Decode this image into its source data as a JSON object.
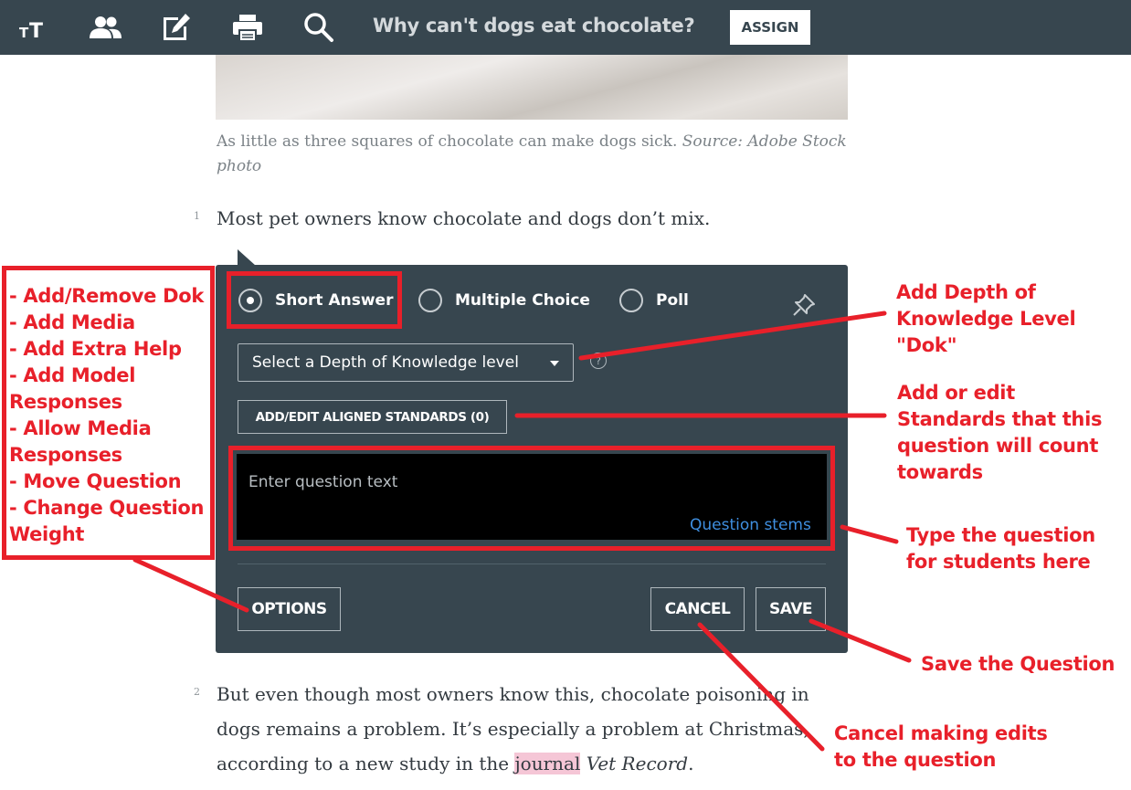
{
  "toolbar": {
    "icons": [
      "text-size-icon",
      "group-icon",
      "edit-icon",
      "print-icon",
      "search-icon"
    ],
    "title": "Why can't dogs eat chocolate?",
    "assign_label": "ASSIGN"
  },
  "article": {
    "caption_text": "As little as three squares of chocolate can make dogs sick. ",
    "caption_source": "Source: Adobe Stock photo",
    "para1_number": "1",
    "para1_text": "Most pet owners know chocolate and dogs don’t mix.",
    "para2_number": "2",
    "para2_line1": "But even though most owners know this, chocolate poisoning in",
    "para2_line2": "dogs remains a problem. It’s especially a problem at Christmas,",
    "para2_line3_pre": "according to a new study in the ",
    "para2_line3_highlight": "journal",
    "para2_line3_italic": "Vet Record",
    "para2_line3_end": "."
  },
  "question_panel": {
    "types": [
      {
        "label": "Short Answer",
        "selected": true
      },
      {
        "label": "Multiple Choice",
        "selected": false
      },
      {
        "label": "Poll",
        "selected": false
      }
    ],
    "dok_select_value": "Select a Depth of Knowledge level",
    "help_glyph": "?",
    "standards_button": "ADD/EDIT ALIGNED STANDARDS (0)",
    "question_placeholder": "Enter question text",
    "question_stems_link": "Question stems",
    "options_button": "OPTIONS",
    "cancel_button": "CANCEL",
    "save_button": "SAVE"
  },
  "annotations": {
    "options_list": "- Add/Remove Dok\n- Add Media\n- Add Extra Help\n- Add Model Responses\n- Allow Media Responses\n- Move Question\n- Change Question Weight",
    "dok": "Add Depth of Knowledge Level \"Dok\"",
    "standards": "Add or edit Standards that this question will count towards",
    "type_question": "Type the question for students here",
    "save": "Save the Question",
    "cancel": "Cancel making edits to the question"
  },
  "colors": {
    "toolbar_bg": "#37464f",
    "panel_bg": "#37464f",
    "annotation_red": "#e8202a",
    "link_blue": "#3f8fe0",
    "highlight_pink": "#f5c6d6"
  }
}
